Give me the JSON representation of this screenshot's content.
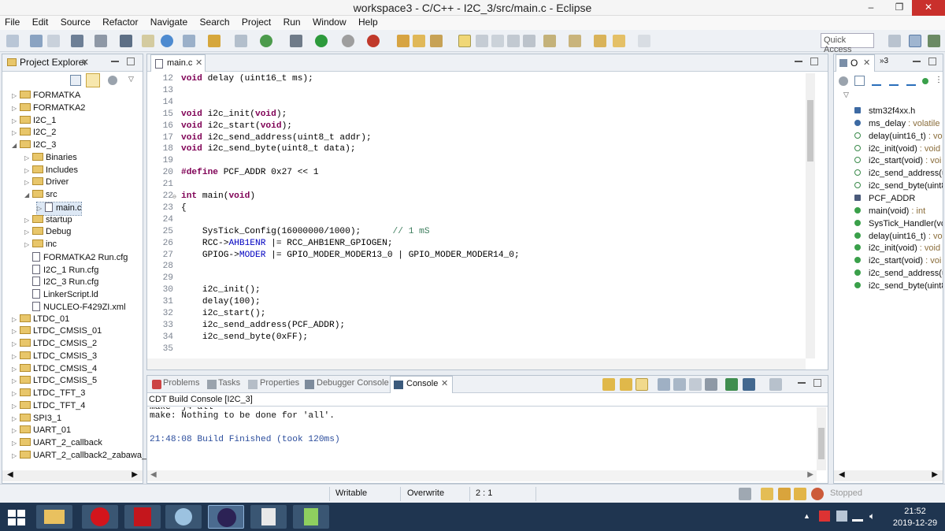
{
  "window": {
    "title": "workspace3 - C/C++ - I2C_3/src/main.c - Eclipse",
    "minimize": "–",
    "maximize": "❐",
    "close": "✕"
  },
  "menu": [
    "File",
    "Edit",
    "Source",
    "Refactor",
    "Navigate",
    "Search",
    "Project",
    "Run",
    "Window",
    "Help"
  ],
  "quick_access": {
    "placeholder": "Quick Access"
  },
  "project_explorer": {
    "title": "Project Explorer",
    "items": [
      {
        "label": "FORMATKA",
        "depth": 0,
        "expanded": false,
        "kind": "project"
      },
      {
        "label": "FORMATKA2",
        "depth": 0,
        "expanded": false,
        "kind": "project"
      },
      {
        "label": "I2C_1",
        "depth": 0,
        "expanded": false,
        "kind": "project"
      },
      {
        "label": "I2C_2",
        "depth": 0,
        "expanded": false,
        "kind": "project"
      },
      {
        "label": "I2C_3",
        "depth": 0,
        "expanded": true,
        "kind": "project"
      },
      {
        "label": "Binaries",
        "depth": 1,
        "expanded": false,
        "kind": "folder"
      },
      {
        "label": "Includes",
        "depth": 1,
        "expanded": false,
        "kind": "folder"
      },
      {
        "label": "Driver",
        "depth": 1,
        "expanded": false,
        "kind": "folder"
      },
      {
        "label": "src",
        "depth": 1,
        "expanded": true,
        "kind": "folder"
      },
      {
        "label": "main.c",
        "depth": 2,
        "expanded": false,
        "kind": "file",
        "selected": true
      },
      {
        "label": "startup",
        "depth": 1,
        "expanded": false,
        "kind": "folder"
      },
      {
        "label": "Debug",
        "depth": 1,
        "expanded": false,
        "kind": "folder"
      },
      {
        "label": "inc",
        "depth": 1,
        "expanded": false,
        "kind": "folder"
      },
      {
        "label": "FORMATKA2 Run.cfg",
        "depth": 1,
        "kind": "file"
      },
      {
        "label": "I2C_1 Run.cfg",
        "depth": 1,
        "kind": "file"
      },
      {
        "label": "I2C_3 Run.cfg",
        "depth": 1,
        "kind": "file"
      },
      {
        "label": "LinkerScript.ld",
        "depth": 1,
        "kind": "file"
      },
      {
        "label": "NUCLEO-F429ZI.xml",
        "depth": 1,
        "kind": "file"
      },
      {
        "label": "LTDC_01",
        "depth": 0,
        "expanded": false,
        "kind": "project"
      },
      {
        "label": "LTDC_CMSIS_01",
        "depth": 0,
        "expanded": false,
        "kind": "project"
      },
      {
        "label": "LTDC_CMSIS_2",
        "depth": 0,
        "expanded": false,
        "kind": "project"
      },
      {
        "label": "LTDC_CMSIS_3",
        "depth": 0,
        "expanded": false,
        "kind": "project"
      },
      {
        "label": "LTDC_CMSIS_4",
        "depth": 0,
        "expanded": false,
        "kind": "project"
      },
      {
        "label": "LTDC_CMSIS_5",
        "depth": 0,
        "expanded": false,
        "kind": "project"
      },
      {
        "label": "LTDC_TFT_3",
        "depth": 0,
        "expanded": false,
        "kind": "project"
      },
      {
        "label": "LTDC_TFT_4",
        "depth": 0,
        "expanded": false,
        "kind": "project"
      },
      {
        "label": "SPI3_1",
        "depth": 0,
        "expanded": false,
        "kind": "project"
      },
      {
        "label": "UART_01",
        "depth": 0,
        "expanded": false,
        "kind": "project"
      },
      {
        "label": "UART_2_callback",
        "depth": 0,
        "expanded": false,
        "kind": "project"
      },
      {
        "label": "UART_2_callback2_zabawa_stı",
        "depth": 0,
        "expanded": false,
        "kind": "project"
      }
    ]
  },
  "editor": {
    "tab": "main.c",
    "lines": [
      {
        "n": "12",
        "code": "void delay (uint16_t ms);"
      },
      {
        "n": "13",
        "code": ""
      },
      {
        "n": "14",
        "code": ""
      },
      {
        "n": "15",
        "code": "void i2c_init(void);"
      },
      {
        "n": "16",
        "code": "void i2c_start(void);"
      },
      {
        "n": "17",
        "code": "void i2c_send_address(uint8_t addr);"
      },
      {
        "n": "18",
        "code": "void i2c_send_byte(uint8_t data);"
      },
      {
        "n": "19",
        "code": ""
      },
      {
        "n": "20",
        "code": "#define PCF_ADDR 0x27 << 1"
      },
      {
        "n": "21",
        "code": ""
      },
      {
        "n": "22",
        "code": "int main(void)"
      },
      {
        "n": "23",
        "code": "{"
      },
      {
        "n": "24",
        "code": ""
      },
      {
        "n": "25",
        "code": "    SysTick_Config(16000000/1000);      // 1 mS"
      },
      {
        "n": "26",
        "code": "    RCC->AHB1ENR |= RCC_AHB1ENR_GPIOGEN;"
      },
      {
        "n": "27",
        "code": "    GPIOG->MODER |= GPIO_MODER_MODER13_0 | GPIO_MODER_MODER14_0;"
      },
      {
        "n": "28",
        "code": ""
      },
      {
        "n": "29",
        "code": ""
      },
      {
        "n": "30",
        "code": "    i2c_init();"
      },
      {
        "n": "31",
        "code": "    delay(100);"
      },
      {
        "n": "32",
        "code": "    i2c_start();"
      },
      {
        "n": "33",
        "code": "    i2c_send_address(PCF_ADDR);"
      },
      {
        "n": "34",
        "code": "    i2c_send_byte(0xFF);"
      },
      {
        "n": "35",
        "code": ""
      }
    ]
  },
  "outline": {
    "tab": "O",
    "extra_tab": "»3",
    "items": [
      {
        "name": "stm32f4xx.h",
        "type": "",
        "kind": "include"
      },
      {
        "name": "ms_delay",
        "type": " : volatile u",
        "kind": "var"
      },
      {
        "name": "delay(uint16_t)",
        "type": " : vo",
        "kind": "decl"
      },
      {
        "name": "i2c_init(void)",
        "type": " : void",
        "kind": "decl"
      },
      {
        "name": "i2c_start(void)",
        "type": " : voi",
        "kind": "decl"
      },
      {
        "name": "i2c_send_address(u",
        "type": "",
        "kind": "decl"
      },
      {
        "name": "i2c_send_byte(uint8",
        "type": "",
        "kind": "decl"
      },
      {
        "name": "PCF_ADDR",
        "type": "",
        "kind": "macro"
      },
      {
        "name": "main(void)",
        "type": " : int",
        "kind": "func"
      },
      {
        "name": "SysTick_Handler(vc",
        "type": "",
        "kind": "func"
      },
      {
        "name": "delay(uint16_t)",
        "type": " : vo",
        "kind": "func"
      },
      {
        "name": "i2c_init(void)",
        "type": " : void",
        "kind": "func"
      },
      {
        "name": "i2c_start(void)",
        "type": " : voi",
        "kind": "func"
      },
      {
        "name": "i2c_send_address(u",
        "type": "",
        "kind": "func"
      },
      {
        "name": "i2c_send_byte(uint8",
        "type": "",
        "kind": "func"
      }
    ]
  },
  "bottom_tabs": {
    "problems": "Problems",
    "tasks": "Tasks",
    "properties": "Properties",
    "debugger_console": "Debugger Console",
    "console": "Console"
  },
  "console": {
    "title": "CDT Build Console [I2C_3]",
    "lines": [
      "make -j4 all",
      "make: Nothing to be done for 'all'.",
      "",
      "21:48:08 Build Finished (took 120ms)"
    ]
  },
  "statusbar": {
    "writable": "Writable",
    "overwrite": "Overwrite",
    "position": "2 : 1",
    "stopped": "Stopped"
  },
  "taskbar": {
    "time": "21:52",
    "date": "2019-12-29"
  },
  "colors": {
    "accent": "#2a6ebb",
    "taskbar": "#1f3550",
    "close": "#c9302c",
    "keyword": "#7f0055",
    "comment": "#3f7f5f"
  }
}
